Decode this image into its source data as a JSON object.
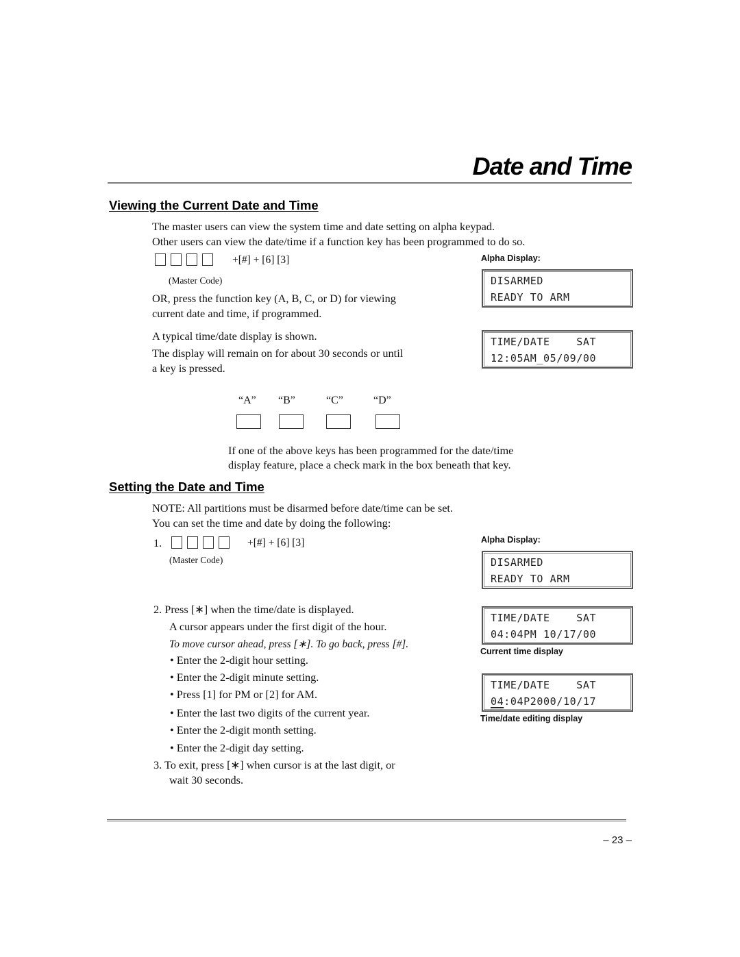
{
  "page": {
    "title": "Date and Time",
    "page_number": "– 23 –"
  },
  "viewing": {
    "heading": "Viewing the Current Date and Time",
    "intro_line1": "The master users can view the system time and date setting on alpha keypad.",
    "intro_line2": "Other users can view the date/time if a function key has been programmed to do so.",
    "key_sequence": "+[#] + [6] [3]",
    "master_code_label": "(Master Code)",
    "or_line1": "OR, press the function key (A, B, C, or D) for viewing",
    "or_line2": "current date and time, if programmed.",
    "typical_line": "A typical time/date display is shown.",
    "remain_line1": "The display will remain on for about 30 seconds or until",
    "remain_line2": "a key is pressed.",
    "alpha_display_label": "Alpha Display:",
    "display_disarmed": {
      "line1": "DISARMED",
      "line2": "READY TO ARM"
    },
    "display_timedate": {
      "line1": "TIME/DATE    SAT",
      "line2": "12:05AM_05/09/00"
    },
    "function_keys": [
      {
        "label": "“A”",
        "checked": false
      },
      {
        "label": "“B”",
        "checked": false
      },
      {
        "label": "“C”",
        "checked": false
      },
      {
        "label": "“D”",
        "checked": false
      }
    ],
    "fkey_note_line1": "If one of the above keys has been programmed for the date/time",
    "fkey_note_line2": "display feature, place a check mark in the box beneath that key."
  },
  "setting": {
    "heading": "Setting the Date and Time",
    "note": "NOTE: All partitions must be disarmed before date/time can be set.",
    "intro": "You can set the time and date by doing the following:",
    "step1_num": "1.",
    "step1_sequence": "+[#] +  [6] [3]",
    "master_code_label": "(Master Code)",
    "step2_line1": "2.  Press [∗] when the time/date is displayed.",
    "step2_line2": "A cursor appears under the first digit of the hour.",
    "step2_italic": "To move cursor ahead, press [∗]. To go back, press [#].",
    "bullets": [
      "• Enter the 2-digit hour setting.",
      "• Enter the 2-digit minute setting.",
      "• Press [1] for PM or [2] for AM.",
      "• Enter the last two digits of the current year.",
      "• Enter the 2-digit month setting.",
      "• Enter the 2-digit day setting."
    ],
    "step3_line1": "3.  To exit, press [∗] when cursor is at the last digit, or",
    "step3_line2": "wait 30 seconds.",
    "alpha_display_label": "Alpha Display:",
    "display_disarmed": {
      "line1": "DISARMED",
      "line2": "READY TO ARM"
    },
    "display_current": {
      "line1": "TIME/DATE    SAT",
      "line2": "04:04PM 10/17/00",
      "caption": "Current time display"
    },
    "display_editing": {
      "line1": "TIME/DATE    SAT",
      "line2_cursor": "04",
      "line2_rest": ":04P2000/10/17",
      "caption": "Time/date editing display"
    }
  }
}
